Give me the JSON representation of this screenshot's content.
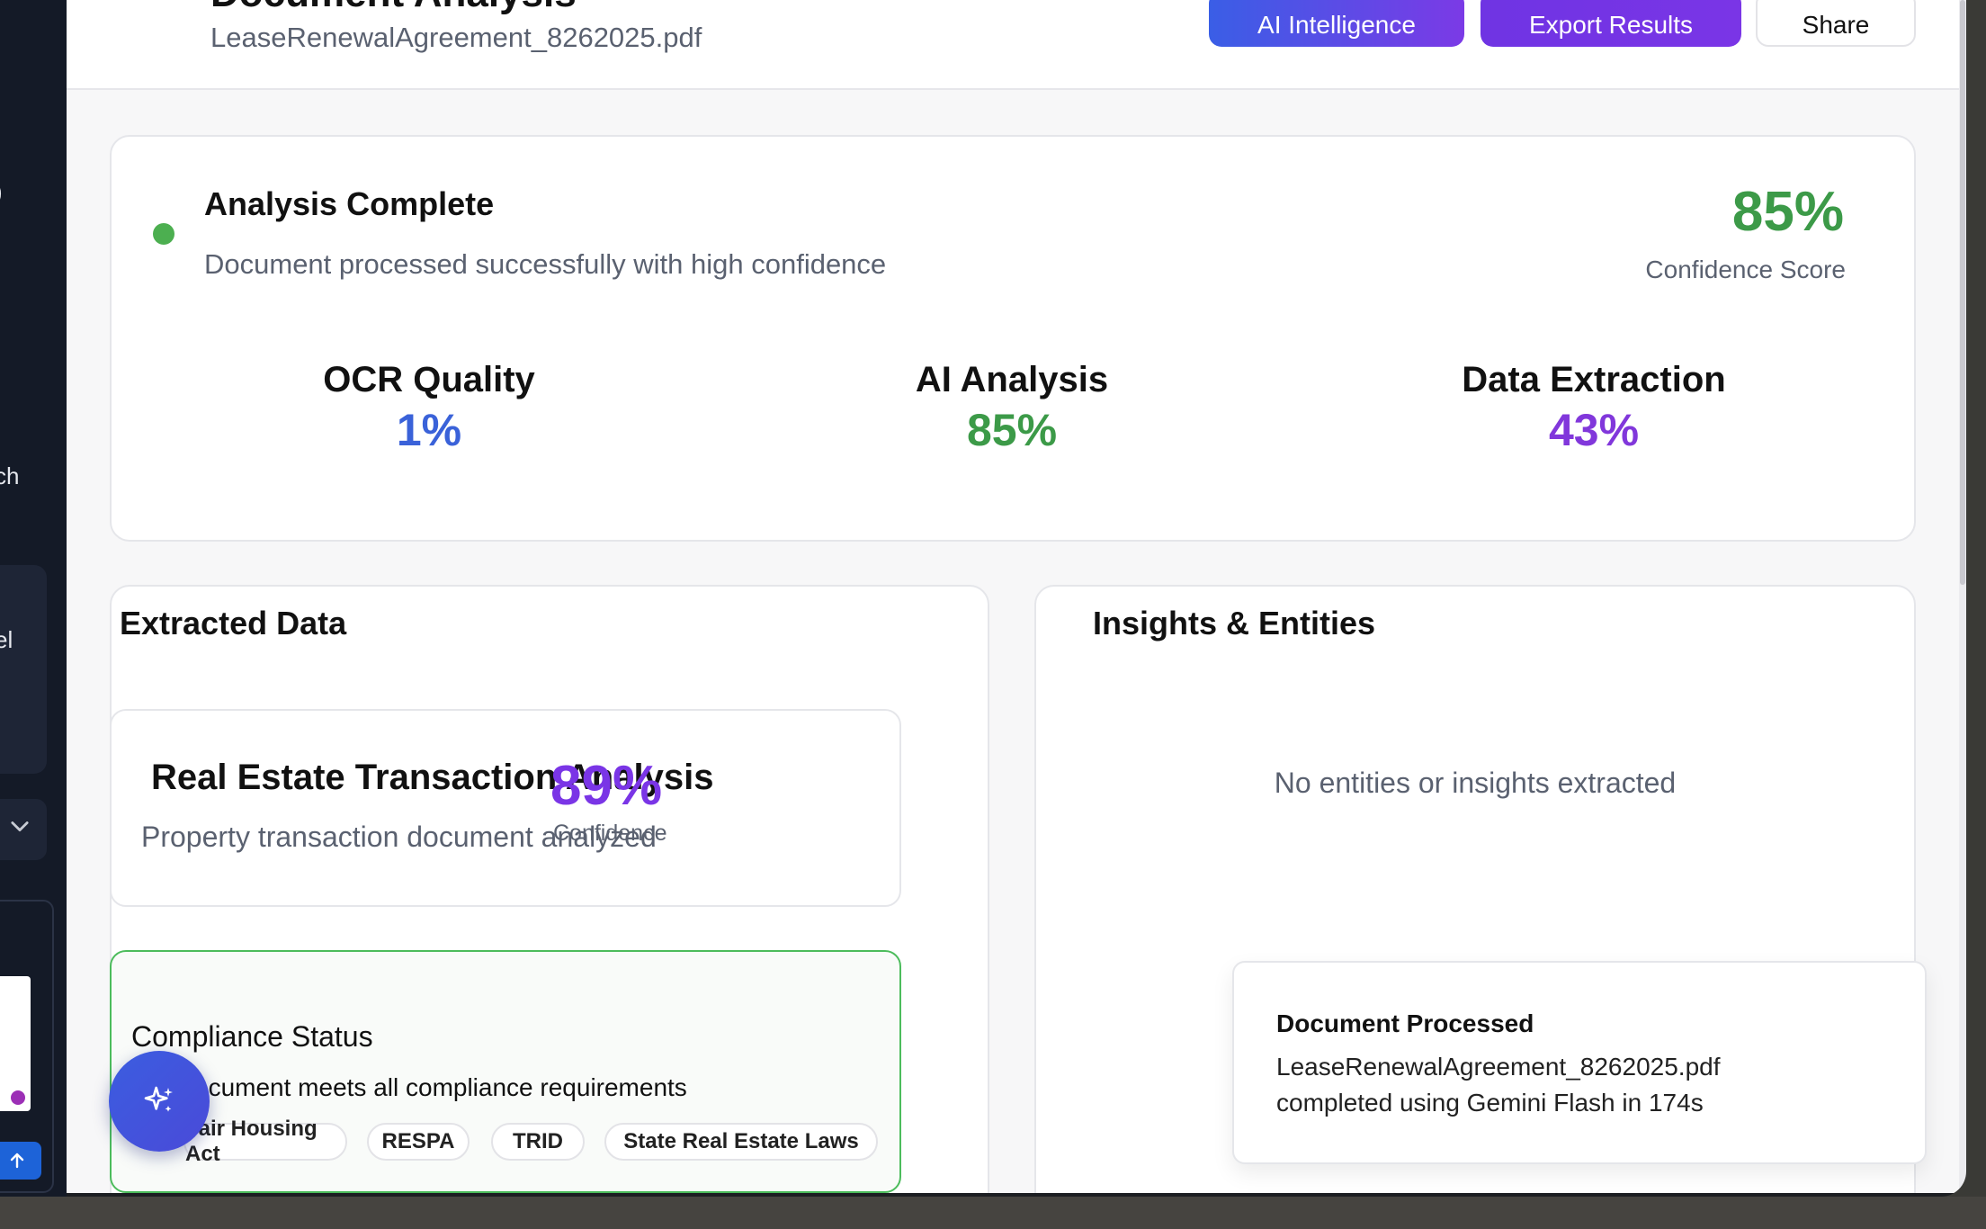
{
  "sidebar": {
    "fragment_1": ")",
    "fragment_2": "ch",
    "fragment_3": "el"
  },
  "header": {
    "title": "Document Analysis",
    "filename": "LeaseRenewalAgreement_8262025.pdf",
    "ai_button": "AI Intelligence",
    "export_button": "Export Results",
    "share_button": "Share"
  },
  "summary": {
    "status_title": "Analysis Complete",
    "status_desc": "Document processed successfully with high confidence",
    "confidence_value": "85%",
    "confidence_label": "Confidence Score",
    "metrics": [
      {
        "label": "OCR Quality",
        "value": "1%",
        "color": "#3a62d9"
      },
      {
        "label": "AI Analysis",
        "value": "85%",
        "color": "#3c9a48"
      },
      {
        "label": "Data Extraction",
        "value": "43%",
        "color": "#8137db"
      }
    ]
  },
  "extracted": {
    "title": "Extracted Data",
    "classification": {
      "title": "Real Estate Transaction Analysis",
      "desc": "Property transaction document analyzed",
      "value": "89%",
      "label": "Confidence"
    },
    "compliance": {
      "title": "Compliance Status",
      "desc": "ocument meets all compliance requirements",
      "tags": [
        "Fair Housing Act",
        "RESPA",
        "TRID",
        "State Real Estate Laws"
      ]
    }
  },
  "insights": {
    "title": "Insights & Entities",
    "empty": "No entities or insights extracted"
  },
  "toast": {
    "title": "Document Processed",
    "line1": "LeaseRenewalAgreement_8262025.pdf",
    "line2": "completed using Gemini Flash in 174s"
  },
  "colors": {
    "success": "#4caf50",
    "accent_blue": "#3a62d9",
    "accent_purple": "#7a35e6"
  }
}
